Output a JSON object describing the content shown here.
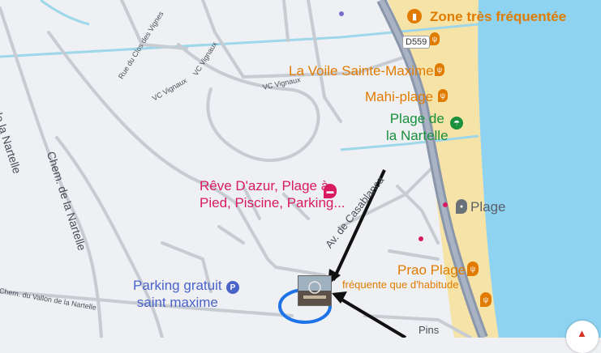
{
  "map": {
    "zone_label": "Zone très fréquentée",
    "road_shield": "D559",
    "pois": {
      "voile": "La Voile Sainte-Maxime",
      "mahi": "Mahi-plage",
      "nartelle_line1": "Plage de",
      "nartelle_line2": "la Nartelle",
      "reve_line1": "Rêve D'azur, Plage à",
      "reve_line2": "Pied, Piscine, Parking...",
      "plage": "Plage",
      "prao": "Prao Plage",
      "busy_note": "fréquente que d'habitude",
      "parking_line1": "Parking gratuit",
      "parking_line2": "saint maxime"
    },
    "roads": {
      "chem_nartelle_1": "Chem. de la Nartelle",
      "chem_nartelle_2": "Chem. de la Nartelle",
      "clos_vignes": "Rue du Clos des Vignes",
      "vc_vignaux_1": "VC Vignaux",
      "vc_vignaux_2": "VC Vignaux",
      "vc_vignaux_3": "VC Vignaux",
      "casablanca": "Av. de Casablanca",
      "vallon": "Chem. du Vallon de la Nartelle",
      "pins": "Pins"
    },
    "colors": {
      "sea": "#8fd3f2",
      "sand": "#f6e3a7",
      "main_road": "#8a96aa",
      "streams": "#9ed7ea",
      "annotation": "#111111",
      "circle": "#1e73e8"
    },
    "icons": [
      "trend-icon",
      "restaurant-icon",
      "beach-icon",
      "place-icon",
      "parking-icon",
      "lodging-icon"
    ]
  }
}
